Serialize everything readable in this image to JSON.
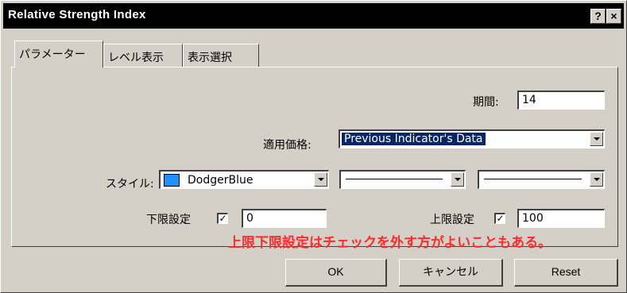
{
  "window": {
    "title": "Relative Strength Index",
    "help_label": "?",
    "close_label": "×"
  },
  "tabs": [
    {
      "label": "パラメーター",
      "active": true
    },
    {
      "label": "レベル表示",
      "active": false
    },
    {
      "label": "表示選択",
      "active": false
    }
  ],
  "params": {
    "period_label": "期間:",
    "period_value": "14",
    "apply_label": "適用価格:",
    "apply_value": "Previous Indicator's Data",
    "style_label": "スタイル:",
    "color_name": "DodgerBlue",
    "color_hex": "#1e90ff"
  },
  "limits": {
    "lower_label": "下限設定",
    "lower_checked": "✓",
    "lower_value": "0",
    "upper_label": "上限設定",
    "upper_checked": "✓",
    "upper_value": "100"
  },
  "annotation": "上限下限設定はチェックを外す方がよいこともある。",
  "buttons": {
    "ok": "OK",
    "cancel": "キャンセル",
    "reset": "Reset"
  }
}
